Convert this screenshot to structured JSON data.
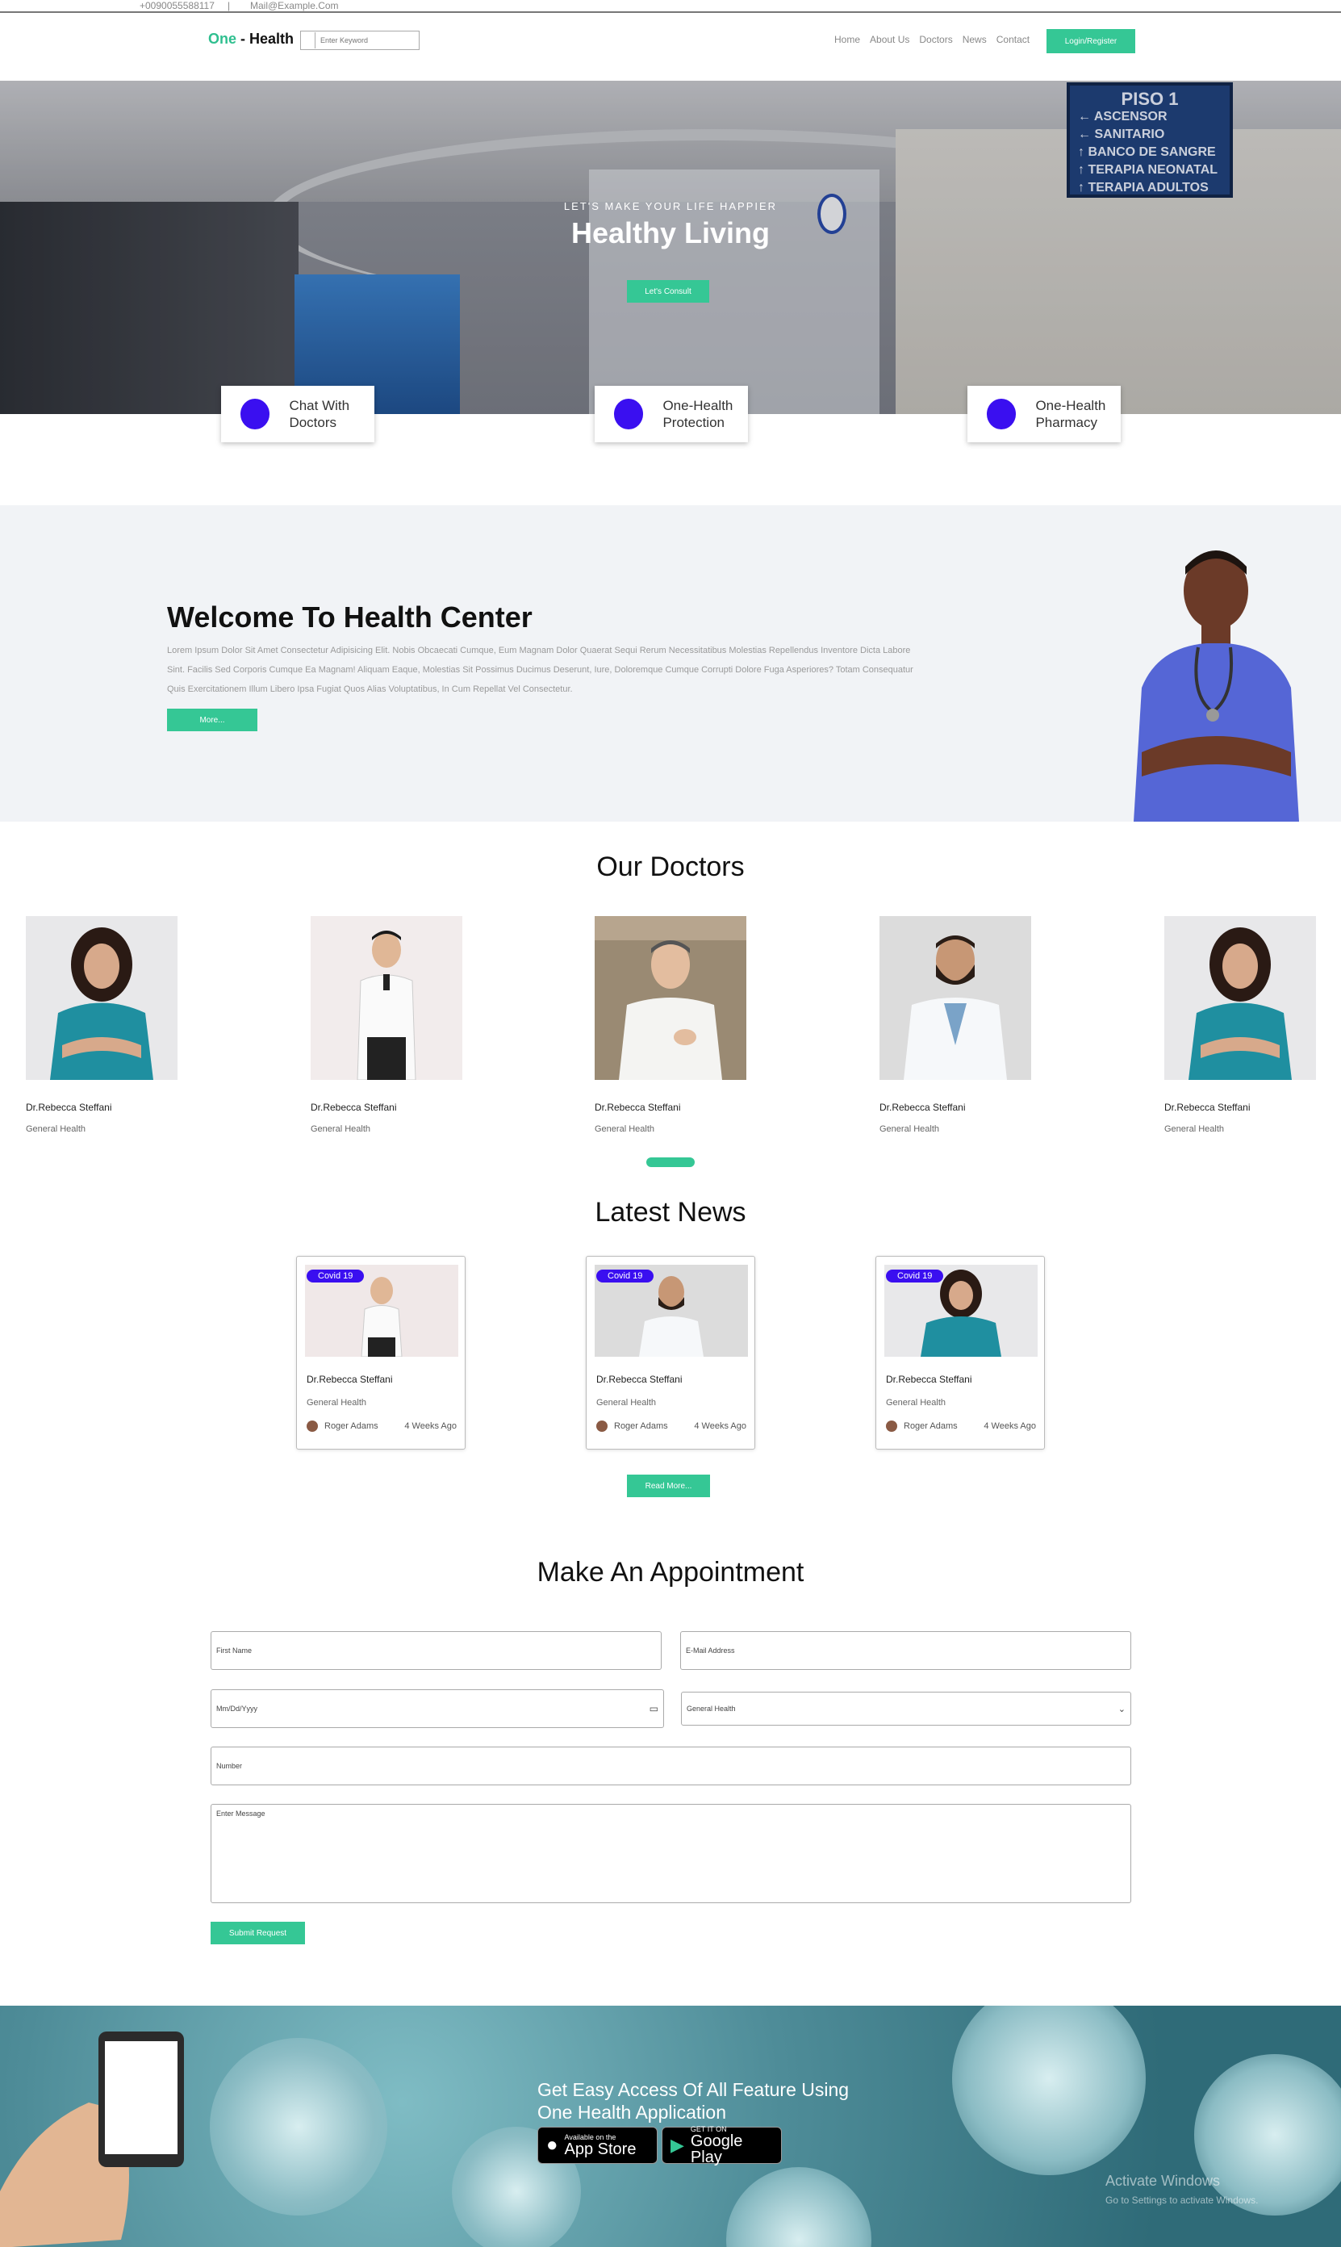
{
  "topbar": {
    "phone": "+0090055588117",
    "separator": "|",
    "mail": "Mail@Example.Com"
  },
  "nav": {
    "logo_one": "One",
    "logo_rest": " - Health",
    "search_placeholder": "Enter Keyword",
    "links": [
      "Home",
      "About Us",
      "Doctors",
      "News",
      "Contact"
    ],
    "login_label": "Login/Register"
  },
  "hero": {
    "subtitle": "LET'S MAKE YOUR LIFE HAPPIER",
    "title": "Healthy Living",
    "cta": "Let's Consult",
    "sign_lines": [
      "PISO 1",
      "← ASCENSOR",
      "← SANITARIO",
      "↑ BANCO DE SANGRE",
      "↑ TERAPIA NEONATAL",
      "↑ TERAPIA ADULTOS"
    ]
  },
  "features": [
    {
      "label": "Chat With Doctors"
    },
    {
      "label": "One-Health Protection"
    },
    {
      "label": "One-Health Pharmacy"
    }
  ],
  "welcome": {
    "title": "Welcome To Health Center",
    "description": "Lorem Ipsum Dolor Sit Amet Consectetur Adipisicing Elit. Nobis Obcaecati Cumque, Eum Magnam Dolor Quaerat Sequi Rerum Necessitatibus Molestias Repellendus Inventore Dicta Labore Sint. Facilis Sed Corporis Cumque Ea Magnam! Aliquam Eaque, Molestias Sit Possimus Ducimus Deserunt, Iure, Doloremque Cumque Corrupti Dolore Fuga Asperiores? Totam Consequatur Quis Exercitationem Illum Libero Ipsa Fugiat Quos Alias Voluptatibus, In Cum Repellat Vel Consectetur.",
    "more_label": "More..."
  },
  "doctors": {
    "title": "Our Doctors",
    "items": [
      {
        "name": "Dr.Rebecca Steffani",
        "specialty": "General Health"
      },
      {
        "name": "Dr.Rebecca Steffani",
        "specialty": "General Health"
      },
      {
        "name": "Dr.Rebecca Steffani",
        "specialty": "General Health"
      },
      {
        "name": "Dr.Rebecca Steffani",
        "specialty": "General Health"
      },
      {
        "name": "Dr.Rebecca Steffani",
        "specialty": "General Health"
      }
    ]
  },
  "news": {
    "title": "Latest News",
    "items": [
      {
        "tag": "Covid 19",
        "name": "Dr.Rebecca Steffani",
        "specialty": "General Health",
        "author": "Roger Adams",
        "time": "4 Weeks Ago"
      },
      {
        "tag": "Covid 19",
        "name": "Dr.Rebecca Steffani",
        "specialty": "General Health",
        "author": "Roger Adams",
        "time": "4 Weeks Ago"
      },
      {
        "tag": "Covid 19",
        "name": "Dr.Rebecca Steffani",
        "specialty": "General Health",
        "author": "Roger Adams",
        "time": "4 Weeks Ago"
      }
    ],
    "read_more": "Read More..."
  },
  "appointment": {
    "title": "Make An Appointment",
    "first_name_placeholder": "First Name",
    "email_placeholder": "E-Mail Address",
    "date_placeholder": "Mm/Dd/Yyyy",
    "department_value": "General Health",
    "number_placeholder": "Number",
    "message_placeholder": "Enter Message",
    "submit_label": "Submit Request"
  },
  "footer": {
    "headline_line1": "Get Easy Access Of All Feature Using",
    "headline_line2": "One Health Application",
    "appstore_small": "Available on the",
    "appstore_big": "App Store",
    "googleplay_small": "GET IT ON",
    "googleplay_big": "Google Play"
  },
  "watermark": {
    "title": "Activate Windows",
    "sub": "Go to Settings to activate Windows."
  },
  "colors": {
    "accent": "#35c795",
    "tag": "#3a0ff0",
    "feature_dot": "#3a0ff0"
  }
}
